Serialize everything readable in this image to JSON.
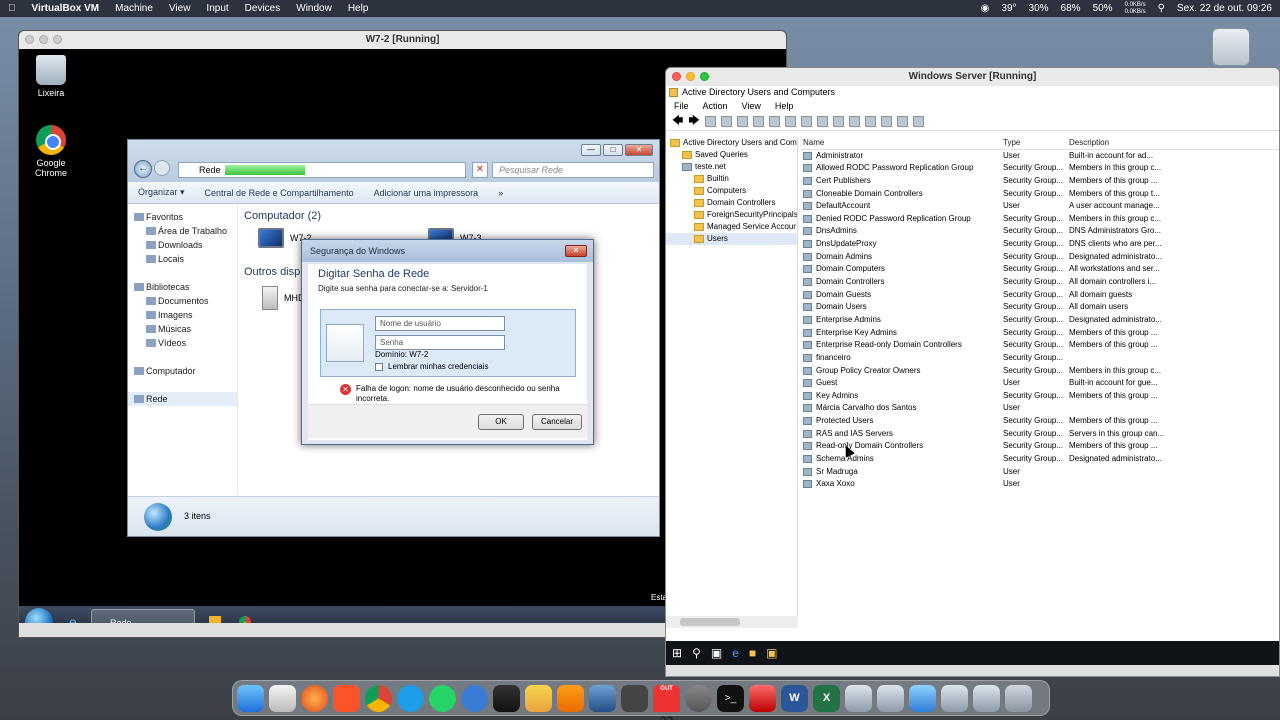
{
  "menubar": {
    "app": "VirtualBox VM",
    "items": [
      "Machine",
      "View",
      "Input",
      "Devices",
      "Window",
      "Help"
    ],
    "status": {
      "temp": "39°",
      "cpu": "30%",
      "mem": "68%",
      "battery": "50%",
      "net_up": "0.0KB/s",
      "net_down": "0.0KB/s",
      "datetime": "Sex. 22 de out. 09:26"
    }
  },
  "vbox_w7": {
    "title": "W7-2 [Running]",
    "desktop_icons": [
      "Lixeira",
      "Google Chrome"
    ],
    "taskbar_item": "Rede",
    "corner_text": "Esta"
  },
  "explorer": {
    "address": "Rede",
    "search_placeholder": "Pesquisar Rede",
    "commands": [
      "Organizar ▾",
      "Central de Rede e Compartilhamento",
      "Adicionar uma impressora",
      "»"
    ],
    "nav": {
      "favorites": "Favoritos",
      "fav_items": [
        "Área de Trabalho",
        "Downloads",
        "Locais"
      ],
      "libraries": "Bibliotecas",
      "lib_items": [
        "Documentos",
        "Imagens",
        "Músicas",
        "Vídeos"
      ],
      "computer": "Computador",
      "network": "Rede"
    },
    "group_computers": "Computador (2)",
    "computers": [
      "W7-2",
      "W7-3"
    ],
    "group_other": "Outros disp",
    "other_device": "MHD",
    "status": "3 itens"
  },
  "dialog": {
    "title": "Segurança do Windows",
    "heading": "Digitar Senha de Rede",
    "subtitle": "Digite sua senha para conectar-se a: Servidor-1",
    "username_placeholder": "Nome de usuário",
    "password_placeholder": "Senha",
    "domain": "Domínio: W7-2",
    "remember": "Lembrar minhas credenciais",
    "error": "Falha de logon: nome de usuário desconhecido ou senha incorreta.",
    "ok": "OK",
    "cancel": "Cancelar"
  },
  "wsrv": {
    "title": "Windows Server [Running]",
    "app_title": "Active Directory Users and Computers",
    "menu": [
      "File",
      "Action",
      "View",
      "Help"
    ],
    "tree": {
      "root": "Active Directory Users and Comp",
      "saved": "Saved Queries",
      "domain": "teste.net",
      "children": [
        "Builtin",
        "Computers",
        "Domain Controllers",
        "ForeignSecurityPrincipals",
        "Managed Service Accour",
        "Users"
      ]
    },
    "columns": [
      "Name",
      "Type",
      "Description"
    ],
    "rows": [
      [
        "Administrator",
        "User",
        "Built-in account for ad..."
      ],
      [
        "Allowed RODC Password Replication Group",
        "Security Group...",
        "Members in this group c..."
      ],
      [
        "Cert Publishers",
        "Security Group...",
        "Members of this group ..."
      ],
      [
        "Cloneable Domain Controllers",
        "Security Group...",
        "Members of this group t..."
      ],
      [
        "DefaultAccount",
        "User",
        "A user account manage..."
      ],
      [
        "Denied RODC Password Replication Group",
        "Security Group...",
        "Members in this group c..."
      ],
      [
        "DnsAdmins",
        "Security Group...",
        "DNS Administrators Gro..."
      ],
      [
        "DnsUpdateProxy",
        "Security Group...",
        "DNS clients who are per..."
      ],
      [
        "Domain Admins",
        "Security Group...",
        "Designated administrato..."
      ],
      [
        "Domain Computers",
        "Security Group...",
        "All workstations and ser..."
      ],
      [
        "Domain Controllers",
        "Security Group...",
        "All domain controllers i..."
      ],
      [
        "Domain Guests",
        "Security Group...",
        "All domain guests"
      ],
      [
        "Domain Users",
        "Security Group...",
        "All domain users"
      ],
      [
        "Enterprise Admins",
        "Security Group...",
        "Designated administrato..."
      ],
      [
        "Enterprise Key Admins",
        "Security Group...",
        "Members of this group ..."
      ],
      [
        "Enterprise Read-only Domain Controllers",
        "Security Group...",
        "Members of this group ..."
      ],
      [
        "financeiro",
        "Security Group...",
        ""
      ],
      [
        "Group Policy Creator Owners",
        "Security Group...",
        "Members in this group c..."
      ],
      [
        "Guest",
        "User",
        "Built-in account for gue..."
      ],
      [
        "Key Admins",
        "Security Group...",
        "Members of this group ..."
      ],
      [
        "Márcia Carvalho dos Santos",
        "User",
        ""
      ],
      [
        "Protected Users",
        "Security Group...",
        "Members of this group ..."
      ],
      [
        "RAS and IAS Servers",
        "Security Group...",
        "Servers in this group can..."
      ],
      [
        "Read-only Domain Controllers",
        "Security Group...",
        "Members of this group ..."
      ],
      [
        "Schema Admins",
        "Security Group...",
        "Designated administrato..."
      ],
      [
        "Sr Madruga",
        "User",
        ""
      ],
      [
        "Xaxa Xoxo",
        "User",
        ""
      ]
    ]
  },
  "dock": {
    "calendar_month": "OUT",
    "calendar_day": "22"
  }
}
